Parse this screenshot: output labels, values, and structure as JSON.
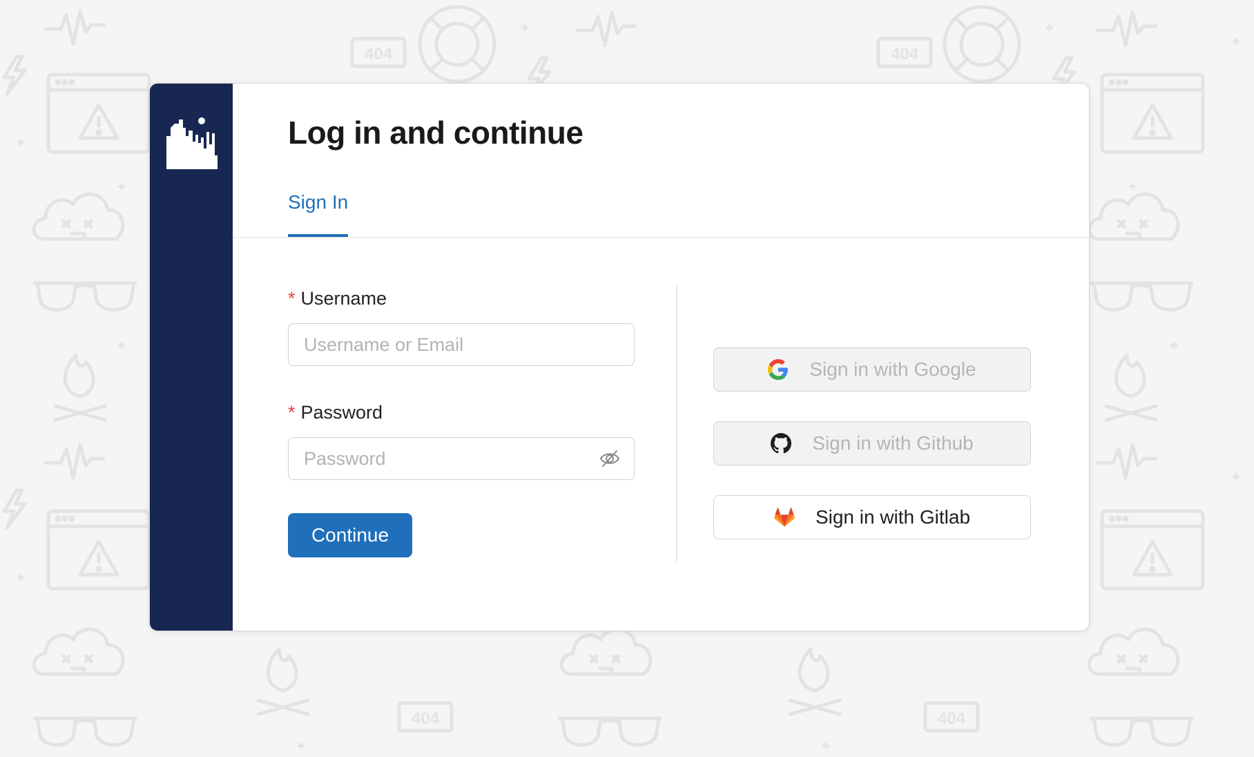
{
  "colors": {
    "sidebar": "#182751",
    "accent": "#1f6fba",
    "required_marker": "#e0423a",
    "background": "#f5f5f5"
  },
  "background_icons": [
    "heartbeat-icon",
    "warning-window-icon",
    "cloud-icon",
    "sunglasses-icon",
    "campfire-icon",
    "lifebuoy-icon",
    "404-icon",
    "runner-icon",
    "shark-fin-icon",
    "eiffel-tower-icon",
    "lightning-icon"
  ],
  "logo": {
    "icon": "city-skyline-logo-icon"
  },
  "page": {
    "title": "Log in and continue"
  },
  "tabs": [
    {
      "label": "Sign In",
      "active": true
    }
  ],
  "form": {
    "username": {
      "required_mark": "*",
      "label": "Username",
      "placeholder": "Username or Email",
      "value": ""
    },
    "password": {
      "required_mark": "*",
      "label": "Password",
      "placeholder": "Password",
      "value": "",
      "toggle_icon": "eye-off-icon"
    },
    "submit_label": "Continue"
  },
  "providers": [
    {
      "label": "Sign in with Google",
      "icon": "google-icon",
      "enabled": false
    },
    {
      "label": "Sign in with Github",
      "icon": "github-icon",
      "enabled": false
    },
    {
      "label": "Sign in with Gitlab",
      "icon": "gitlab-icon",
      "enabled": true
    }
  ]
}
